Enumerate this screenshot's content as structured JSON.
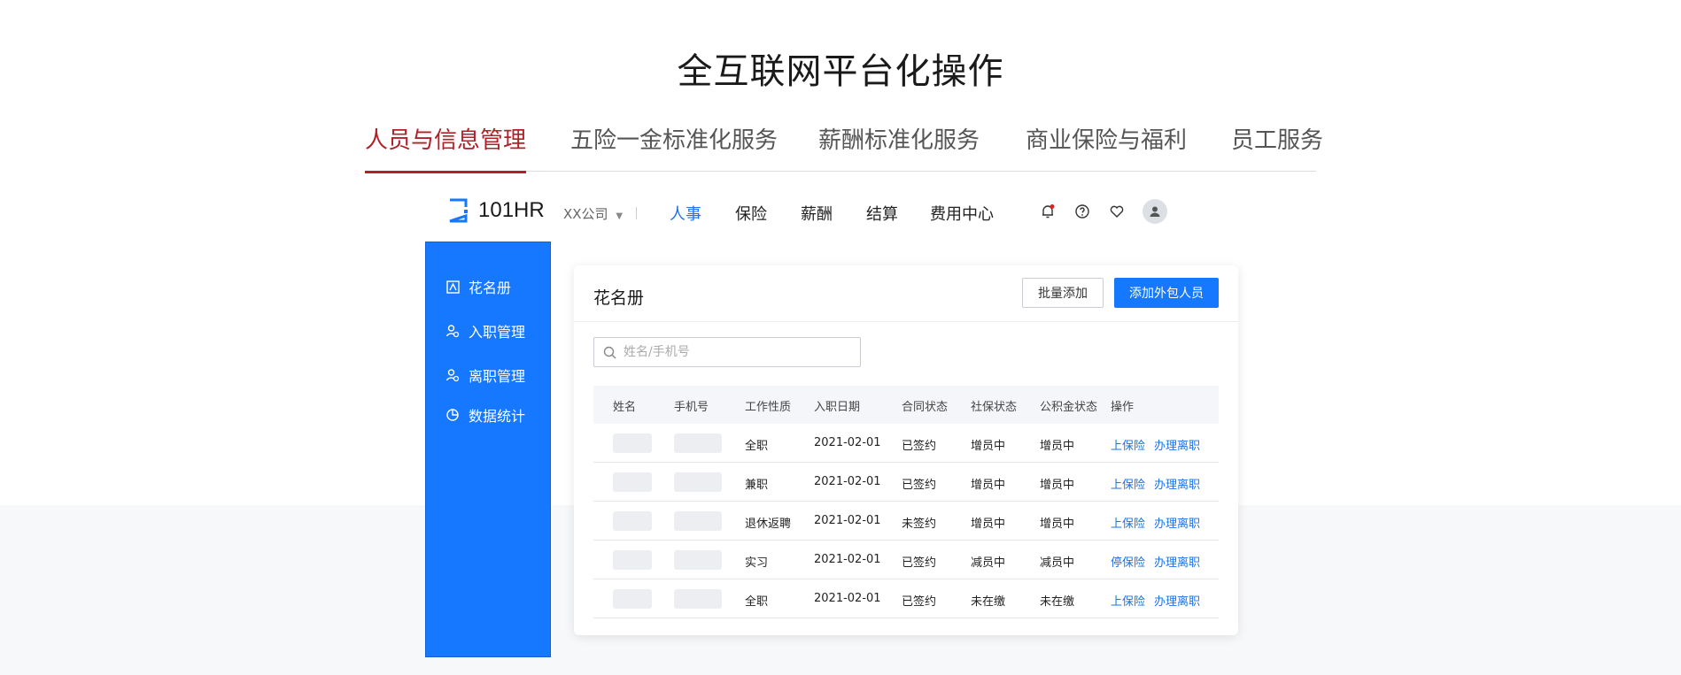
{
  "page": {
    "title": "全互联网平台化操作"
  },
  "tabs": [
    {
      "label": "人员与信息管理",
      "active": true
    },
    {
      "label": "五险一金标准化服务",
      "active": false
    },
    {
      "label": "薪酬标准化服务",
      "active": false
    },
    {
      "label": "商业保险与福利",
      "active": false
    },
    {
      "label": "员工服务",
      "active": false
    }
  ],
  "topbar": {
    "logo_text": "101HR",
    "company": "XX公司",
    "nav": [
      "人事",
      "保险",
      "薪酬",
      "结算",
      "费用中心"
    ],
    "active_nav": "人事",
    "icons": [
      "bell-icon",
      "help-icon",
      "heart-icon",
      "user-avatar-icon"
    ]
  },
  "sidebar": {
    "items": [
      {
        "label": "花名册",
        "icon": "roster-icon"
      },
      {
        "label": "入职管理",
        "icon": "user-add-icon"
      },
      {
        "label": "离职管理",
        "icon": "user-remove-icon"
      },
      {
        "label": "数据统计",
        "icon": "pie-chart-icon"
      }
    ]
  },
  "card": {
    "title": "花名册",
    "batch_add": "批量添加",
    "add_outsource": "添加外包人员",
    "search_placeholder": "姓名/手机号"
  },
  "table": {
    "headers": [
      "姓名",
      "手机号",
      "工作性质",
      "入职日期",
      "合同状态",
      "社保状态",
      "公积金状态",
      "操作"
    ],
    "rows": [
      {
        "type": "全职",
        "date": "2021-02-01",
        "contract": "已签约",
        "social": "增员中",
        "fund": "增员中",
        "action1": "上保险",
        "action2": "办理离职"
      },
      {
        "type": "兼职",
        "date": "2021-02-01",
        "contract": "已签约",
        "social": "增员中",
        "fund": "增员中",
        "action1": "上保险",
        "action2": "办理离职"
      },
      {
        "type": "退休返聘",
        "date": "2021-02-01",
        "contract": "未签约",
        "social": "增员中",
        "fund": "增员中",
        "action1": "上保险",
        "action2": "办理离职"
      },
      {
        "type": "实习",
        "date": "2021-02-01",
        "contract": "已签约",
        "social": "减员中",
        "fund": "减员中",
        "action1": "停保险",
        "action2": "办理离职"
      },
      {
        "type": "全职",
        "date": "2021-02-01",
        "contract": "已签约",
        "social": "未在缴",
        "fund": "未在缴",
        "action1": "上保险",
        "action2": "办理离职"
      }
    ]
  },
  "colors": {
    "accent_red": "#b32027",
    "primary_blue": "#1677ff",
    "link_blue": "#1a73e8"
  }
}
